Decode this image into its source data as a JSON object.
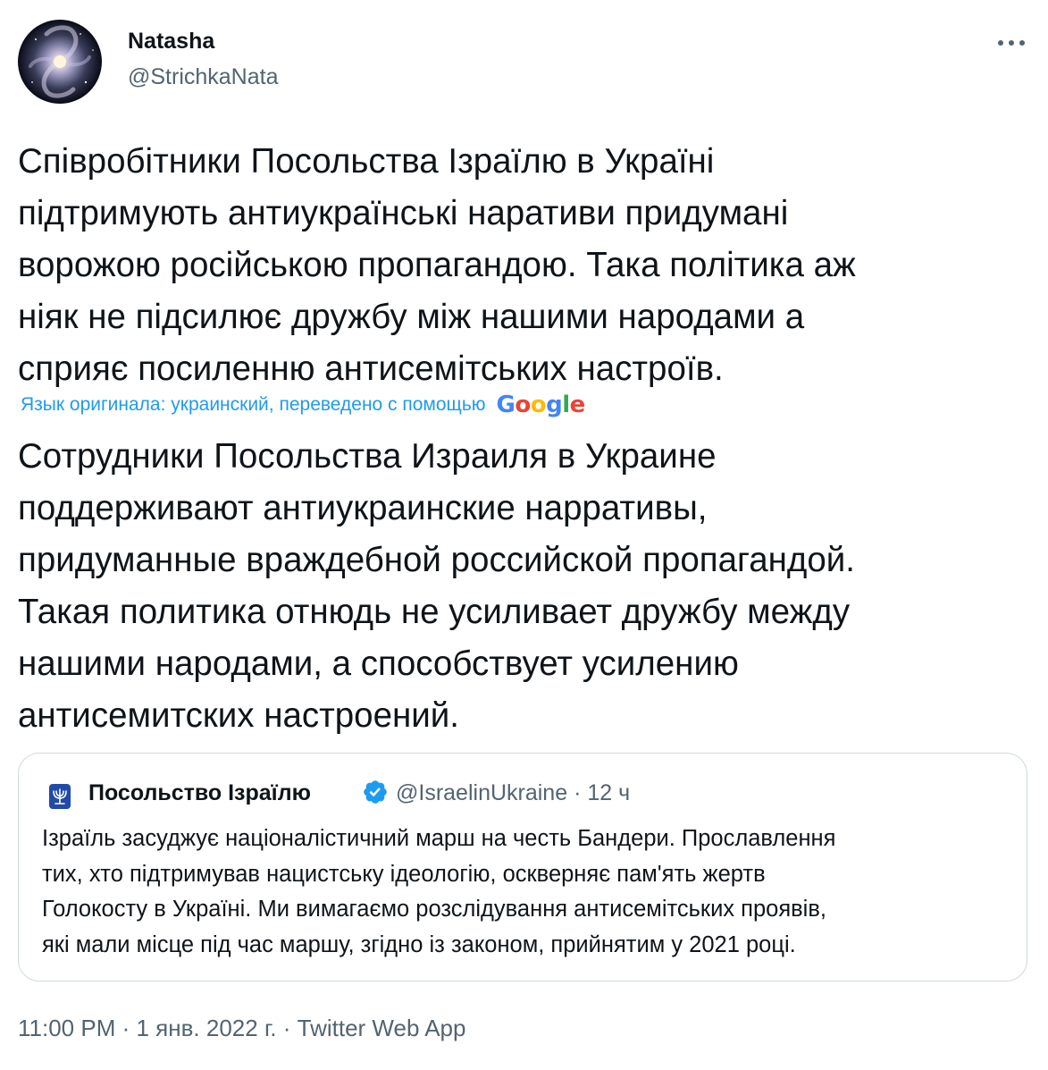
{
  "author": {
    "display_name": "Natasha",
    "handle": "@StrichkaNata"
  },
  "more_icon": "more-horizontal-icon",
  "tweet": {
    "original_text": "Співробітники Посольства Ізраїлю в Україні\nпідтримують антиукраїнські наративи придумані\nворожою російською пропагандою. Така політика аж\nніяк не підсилює дружбу між нашими народами а\nсприяє посиленню антисемітських настроїв.",
    "translation_note": "Язык оригинала: украинский, переведено с помощью",
    "translation_brand": "Google",
    "translated_text": "Сотрудники Посольства Израиля в Украине\nподдерживают антиукраинские нарративы,\nпридуманные враждебной российской пропагандой.\nТакая политика отнюдь не усиливает дружбу между\nнашими народами, а способствует усилению\nантисемитских настроений."
  },
  "quoted_tweet": {
    "display_name": "Посольство Ізраїлю",
    "verified": true,
    "handle": "@IsraelinUkraine",
    "separator": "·",
    "time_ago": "12 ч",
    "text": "Ізраїль засуджує націоналістичний марш на честь Бандери. Прославлення\nтих, хто підтримував нацистську ідеологію, оскверняє пам'ять жертв\nГолокосту в Україні. Ми вимагаємо розслідування антисемітських проявів,\nякі мали місце під час маршу, згідно із законом, прийнятим у 2021 році."
  },
  "meta": {
    "time": "11:00 PM",
    "separator": "·",
    "date": "1 янв. 2022 г.",
    "source": "Twitter Web App"
  },
  "colors": {
    "text_primary": "#0f1419",
    "text_secondary": "#536471",
    "accent": "#1d9bf0",
    "border": "#cfd9de",
    "google_blue": "#4285f4",
    "google_red": "#ea4335",
    "google_yellow": "#fbbc05",
    "google_green": "#34a853"
  }
}
